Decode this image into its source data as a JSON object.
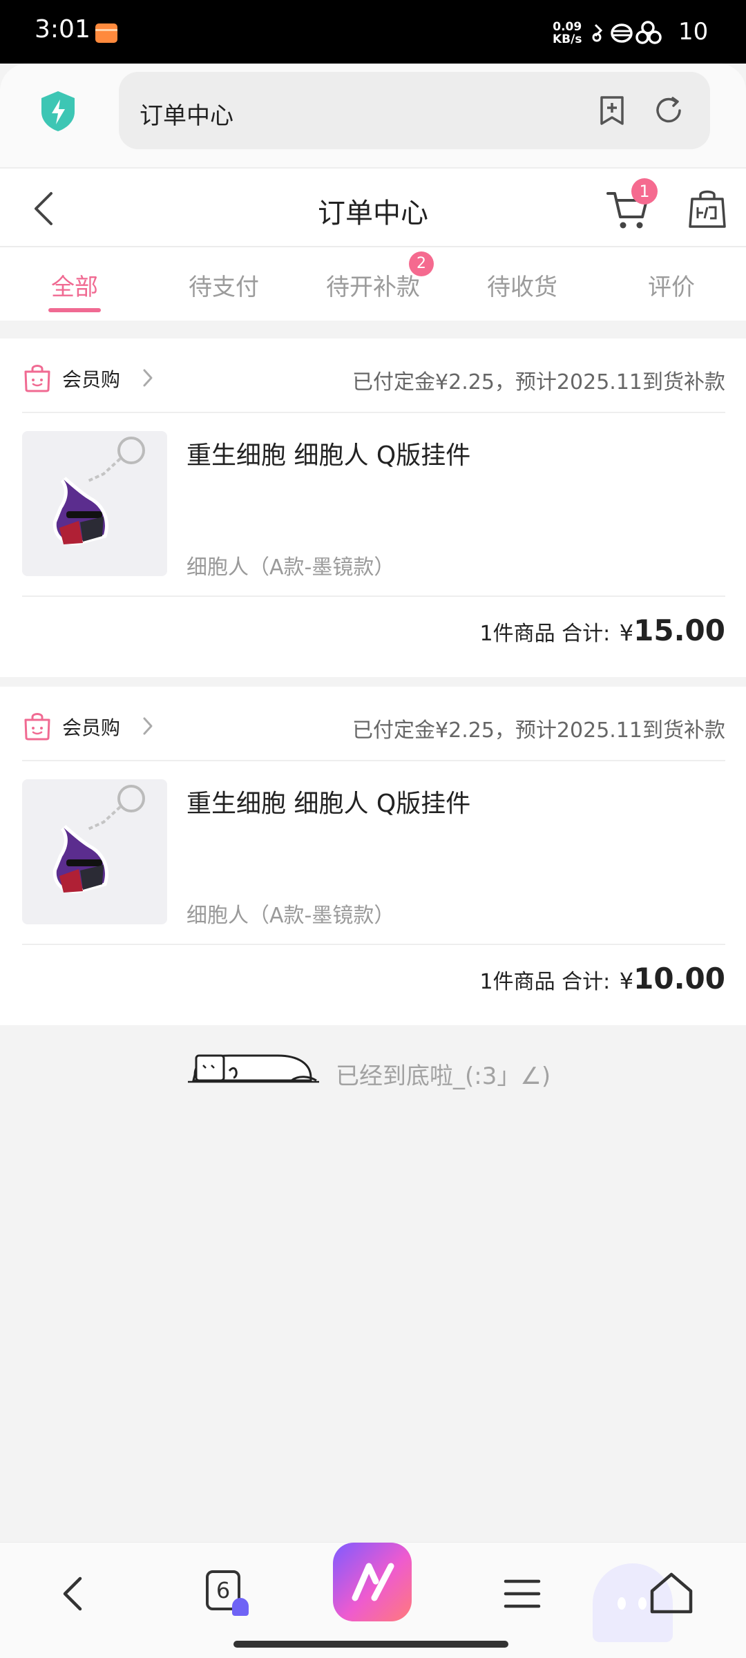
{
  "status_bar": {
    "time": "3:01",
    "net_speed_value": "0.09",
    "net_speed_unit": "KB/s",
    "battery": "10"
  },
  "browser": {
    "url_title": "订单中心"
  },
  "header": {
    "title": "订单中心",
    "cart_badge": "1"
  },
  "tabs": [
    {
      "label": "全部",
      "active": true
    },
    {
      "label": "待支付",
      "active": false
    },
    {
      "label": "待开补款",
      "active": false,
      "badge": "2"
    },
    {
      "label": "待收货",
      "active": false
    },
    {
      "label": "评价",
      "active": false
    }
  ],
  "orders": [
    {
      "shop": "会员购",
      "status": "已付定金¥2.25，预计2025.11到货补款",
      "product_name": "重生细胞 细胞人 Q版挂件",
      "variant": "细胞人（A款-墨镜款）",
      "count_text": "1件商品",
      "total_label": "合计:",
      "currency": "¥",
      "total": "15.00"
    },
    {
      "shop": "会员购",
      "status": "已付定金¥2.25，预计2025.11到货补款",
      "product_name": "重生细胞 细胞人 Q版挂件",
      "variant": "细胞人（A款-墨镜款）",
      "count_text": "1件商品",
      "total_label": "合计:",
      "currency": "¥",
      "total": "10.00"
    }
  ],
  "end_text": "已经到底啦_(:3」∠)",
  "bottom_nav": {
    "tab_count": "6"
  },
  "colors": {
    "accent": "#f06a92",
    "badge": "#f56a8f",
    "muted": "#9a9a9a"
  }
}
